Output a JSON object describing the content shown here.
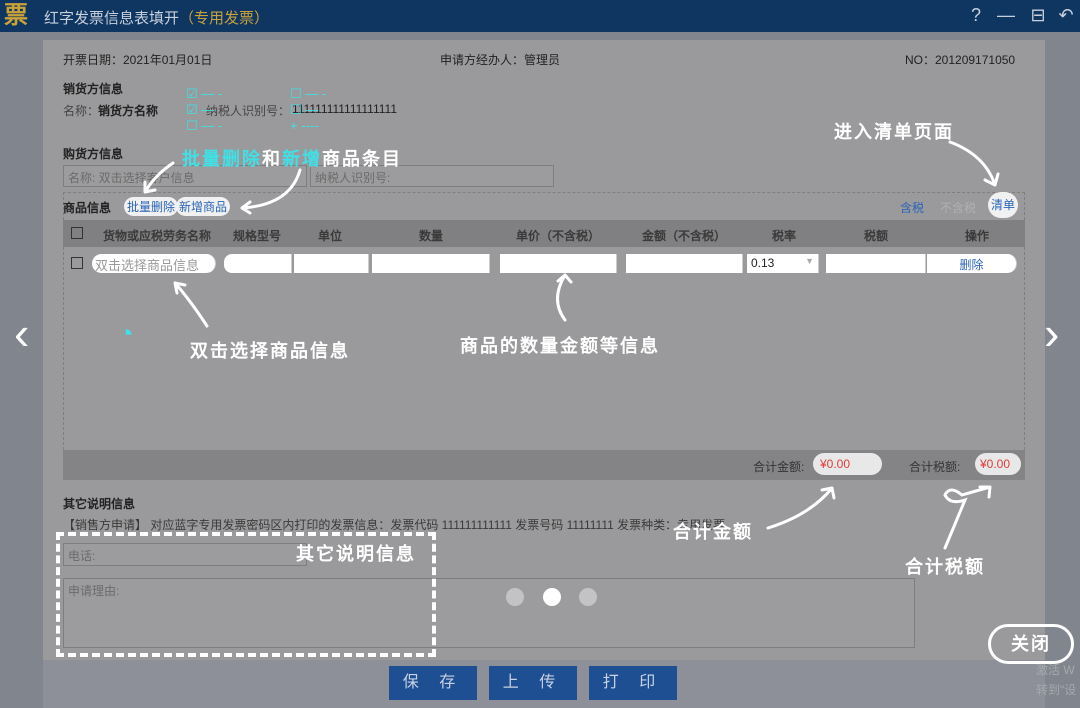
{
  "window": {
    "title": "红字发票信息表填开",
    "title_sub": "（专用发票）",
    "logo": "票",
    "help": "?",
    "minimize": "—",
    "maximize": "⊟",
    "back": "↶"
  },
  "header": {
    "date": "开票日期：2021年01月01日",
    "agent": "申请方经办人：管理员",
    "no": "NO：201209171050"
  },
  "seller": {
    "heading": "销货方信息",
    "name_label": "名称：",
    "name_value": "销货方名称",
    "tax_label": "纳税人识别号：",
    "tax_value": "111111111111111111"
  },
  "buyer": {
    "heading": "购货方信息",
    "name_placeholder": "名称: 双击选择客户信息",
    "tax_placeholder": "纳税人识别号:"
  },
  "goods": {
    "heading": "商品信息",
    "batch_delete": "批量删除",
    "add_item": "新增商品",
    "tax_incl": "含税",
    "tax_excl": "不含税",
    "list": "清单",
    "columns": [
      "货物或应税劳务名称",
      "规格型号",
      "单位",
      "数量",
      "单价（不含税）",
      "金额（不含税）",
      "税率",
      "税额",
      "操作"
    ],
    "row": {
      "name_placeholder": "双击选择商品信息",
      "tax_rate": "0.13",
      "action": "删除"
    },
    "total_amount_label": "合计金额:",
    "total_amount": "¥0.00",
    "total_tax_label": "合计税额:",
    "total_tax": "¥0.00"
  },
  "other": {
    "heading": "其它说明信息",
    "statement": "【销售方申请】 对应蓝字专用发票密码区内打印的发票信息：发票代码 111111111111 发票号码 11111111 发票种类：专用发票",
    "phone_placeholder": "电话:",
    "reason_placeholder": "申请理由:"
  },
  "buttons": {
    "save": "保 存",
    "upload": "上 传",
    "print": "打 印"
  },
  "annotations": {
    "batch_a": "批量删除",
    "and": "和",
    "batch_b": "新增",
    "batch_c": "商品条目",
    "list": "进入清单页面",
    "select": "双击选择商品信息",
    "qty": "商品的数量金额等信息",
    "total_amount": "合计金额",
    "total_tax": "合计税额",
    "other": "其它说明信息",
    "close": "关闭"
  },
  "carousel": {
    "pages": 3,
    "active": 2
  },
  "watermark": [
    "激活 W",
    "转到\"设"
  ],
  "colors": {
    "titlebar": "#0f3561",
    "accent": "#1e4f93",
    "highlight": "#3fe0e6",
    "amount": "#e03b3b"
  }
}
